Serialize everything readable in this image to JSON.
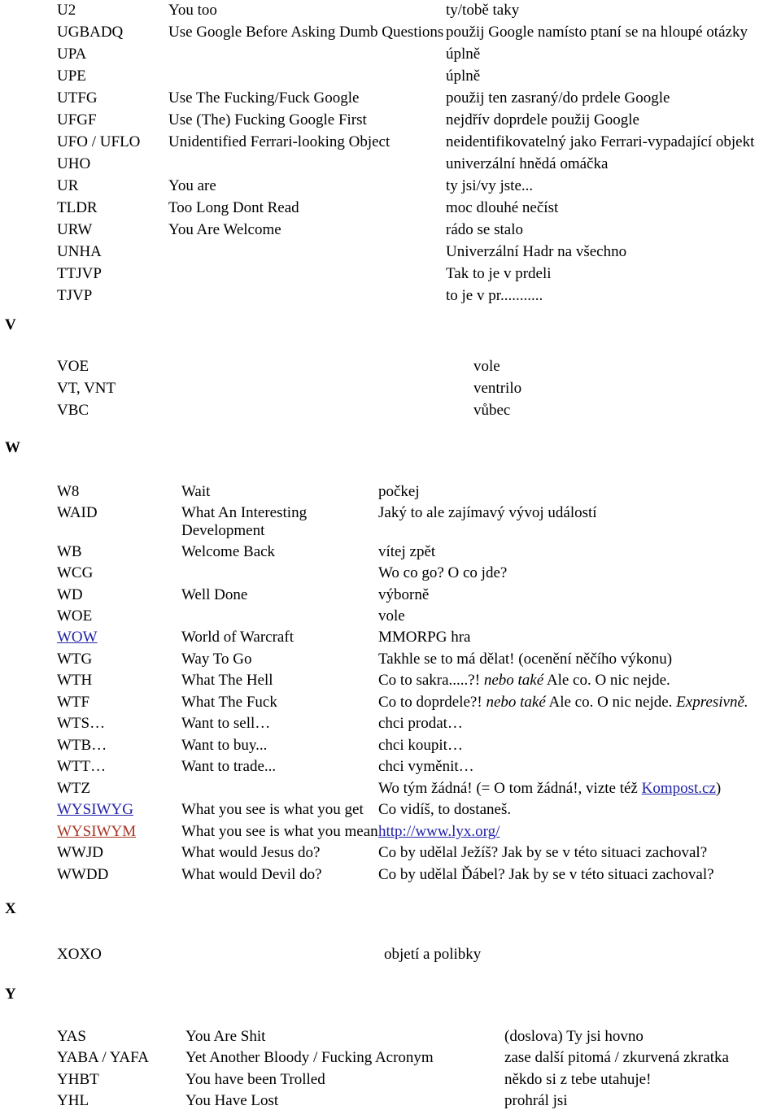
{
  "document": {
    "kind": "acronym-glossary",
    "link_color": "#2222a8",
    "visited_link_color": "#a63524",
    "text_color": "#000000",
    "background": "#ffffff"
  },
  "sections": [
    {
      "letter": "",
      "rows": [
        {
          "abbr": "U2",
          "en": "You too",
          "cs": "ty/tobě taky"
        },
        {
          "abbr": "UGBADQ",
          "en": "Use Google Before Asking Dumb Questions",
          "cs": "použij Google namísto ptaní se na hloupé otázky"
        },
        {
          "abbr": "UPA",
          "en": "",
          "cs": "úplně"
        },
        {
          "abbr": "UPE",
          "en": "",
          "cs": "úplně"
        },
        {
          "abbr": "UTFG",
          "en": "Use The Fucking/Fuck Google",
          "cs": "použij ten zasraný/do prdele Google"
        },
        {
          "abbr": "UFGF",
          "en": "Use (The) Fucking Google First",
          "cs": "nejdřív doprdele použij Google"
        },
        {
          "abbr": "UFO / UFLO",
          "en": "Unidentified Ferrari-looking Object",
          "cs": "neidentifikovatelný jako Ferrari-vypadající objekt"
        },
        {
          "abbr": "UHO",
          "en": "",
          "cs": "univerzální hnědá omáčka"
        },
        {
          "abbr": "UR",
          "en": "You are",
          "cs": "ty jsi/vy jste..."
        },
        {
          "abbr": "TLDR",
          "en": "Too Long Dont Read",
          "cs": "moc dlouhé nečíst"
        },
        {
          "abbr": "URW",
          "en": "You Are Welcome",
          "cs": "rádo se stalo"
        },
        {
          "abbr": "UNHA",
          "en": "",
          "cs": "Univerzální Hadr na všechno"
        },
        {
          "abbr": "TTJVP",
          "en": "",
          "cs": "Tak to je v prdeli"
        },
        {
          "abbr": "TJVP",
          "en": "",
          "cs": "to je v pr..........."
        }
      ]
    },
    {
      "letter": "V",
      "rows": [
        {
          "abbr": "VOE",
          "en": "",
          "cs": "vole"
        },
        {
          "abbr": "VT, VNT",
          "en": "",
          "cs": "ventrilo"
        },
        {
          "abbr": "VBC",
          "en": "",
          "cs": "vůbec"
        }
      ]
    },
    {
      "letter": "W",
      "rows": [
        {
          "abbr": "W8",
          "en": "Wait",
          "cs": "počkej"
        },
        {
          "abbr": "WAID",
          "en": "What An Interesting Development",
          "cs": "Jaký to ale zajímavý vývoj událostí"
        },
        {
          "abbr": "WB",
          "en": "Welcome Back",
          "cs": "vítej zpět"
        },
        {
          "abbr": "WCG",
          "en": "",
          "cs": "Wo co go? O co jde?"
        },
        {
          "abbr": "WD",
          "en": "Well Done",
          "cs": "výborně"
        },
        {
          "abbr": "WOE",
          "en": "",
          "cs": "vole"
        },
        {
          "abbr": "WOW",
          "en": "World of Warcraft",
          "cs": "MMORPG hra"
        },
        {
          "abbr": "WTG",
          "en": "Way To Go",
          "cs": "Takhle se to má dělat! (ocenění něčího výkonu)"
        },
        {
          "abbr": "WTH",
          "en": "What The Hell",
          "cs": "Co to sakra.....?! nebo také Ale co. O nic nejde."
        },
        {
          "abbr": "WTF",
          "en": "What The Fuck",
          "cs": "Co to doprdele?! nebo také Ale co. O nic nejde. Expresivně."
        },
        {
          "abbr": "WTS…",
          "en": "Want to sell…",
          "cs": "chci prodat…"
        },
        {
          "abbr": "WTB…",
          "en": "Want to buy...",
          "cs": "chci koupit…"
        },
        {
          "abbr": "WTT…",
          "en": "Want to trade...",
          "cs": "chci vyměnit…"
        },
        {
          "abbr": "WTZ",
          "en": "",
          "cs": "Wo tým žádná! (= O tom žádná!, vizte též Kompost.cz)"
        },
        {
          "abbr": "WYSIWYG",
          "en": "What you see is what you get",
          "cs": "Co vidíš, to dostaneš."
        },
        {
          "abbr": "WYSIWYM",
          "en": "What you see is what you mean",
          "cs": "http://www.lyx.org/"
        },
        {
          "abbr": "WWJD",
          "en": "What would Jesus do?",
          "cs": "Co by udělal Ježíš? Jak by se v této situaci zachoval?"
        },
        {
          "abbr": "WWDD",
          "en": "What would Devil do?",
          "cs": "Co by udělal Ďábel? Jak by se v této situaci zachoval?"
        }
      ]
    },
    {
      "letter": "X",
      "rows": [
        {
          "abbr": "XOXO",
          "en": "",
          "cs": "objetí a polibky"
        }
      ]
    },
    {
      "letter": "Y",
      "rows": [
        {
          "abbr": "YAS",
          "en": "You Are Shit",
          "cs": "(doslova) Ty jsi hovno"
        },
        {
          "abbr": "YABA / YAFA",
          "en": "Yet Another Bloody / Fucking Acronym",
          "cs": "zase další pitomá / zkurvená zkratka"
        },
        {
          "abbr": "YHBT",
          "en": "You have been Trolled",
          "cs": "někdo si z tebe utahuje!"
        },
        {
          "abbr": "YHL",
          "en": "You Have Lost",
          "cs": "prohrál jsi"
        }
      ]
    }
  ],
  "fragments": {
    "wtz_prefix": "Wo tým žádná! (= O tom žádná!, vizte též ",
    "wtz_link": "Kompost.cz",
    "wtz_suffix": ")",
    "wth_a": "Co to sakra.....?! ",
    "wth_i": "nebo také",
    "wth_b": " Ale co. O nic nejde.",
    "wtf_a": "Co to doprdele?! ",
    "wtf_i": "nebo také",
    "wtf_b": " Ale co. O nic nejde. ",
    "wtf_i2": "Expresivně.",
    "lyx_url": "http://www.lyx.org/",
    "waid_en_line1": "What An Interesting",
    "waid_en_line2": "Development"
  }
}
